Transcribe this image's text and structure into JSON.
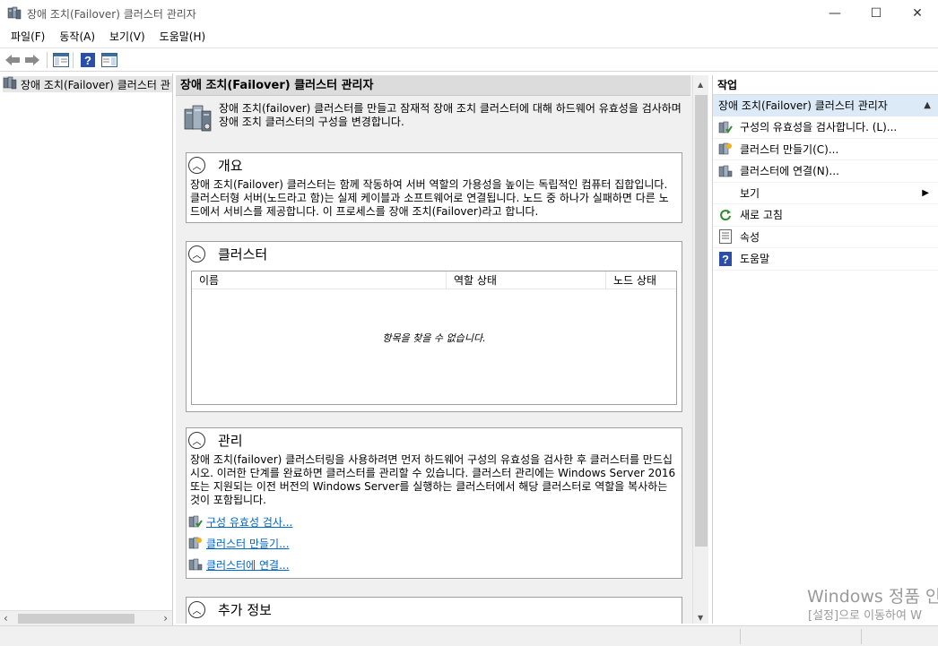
{
  "window": {
    "title": "장애 조치(Failover) 클러스터 관리자",
    "minimize": "—",
    "maximize": "☐",
    "close": "✕"
  },
  "menu": [
    "파일(F)",
    "동작(A)",
    "보기(V)",
    "도움말(H)"
  ],
  "tree": {
    "root_label": "장애 조치(Failover) 클러스터 관"
  },
  "center": {
    "header": "장애 조치(Failover) 클러스터 관리자",
    "intro": "장애 조치(failover) 클러스터를 만들고 잠재적 장애 조치 클러스터에 대해 하드웨어 유효성을 검사하며 장애 조치 클러스터의 구성을 변경합니다.",
    "overview": {
      "title": "개요",
      "body": "장애 조치(Failover) 클러스터는 함께 작동하여 서버 역할의 가용성을 높이는 독립적인 컴퓨터 집합입니다. 클러스터형 서버(노드라고 함)는 실제 케이블과 소프트웨어로 연결됩니다. 노드 중 하나가 실패하면 다른 노드에서 서비스를 제공합니다. 이 프로세스를 장애 조치(Failover)라고 합니다."
    },
    "clusters": {
      "title": "클러스터",
      "columns": [
        "이름",
        "역할 상태",
        "노드 상태"
      ],
      "empty": "항목을 찾을 수 없습니다."
    },
    "manage": {
      "title": "관리",
      "body": "장애 조치(failover) 클러스터링을 사용하려면 먼저 하드웨어 구성의 유효성을 검사한 후 클러스터를 만드십시오. 이러한 단계를 완료하면 클러스터를 관리할 수 있습니다. 클러스터 관리에는 Windows Server 2016 또는 지원되는 이전 버전의 Windows Server를 실행하는 클러스터에서 해당 클러스터로 역할을 복사하는 것이 포함됩니다.",
      "links": [
        "구성 유효성 검사...",
        "클러스터 만들기...",
        "클러스터에 연결..."
      ]
    },
    "more_info": {
      "title": "추가 정보"
    }
  },
  "actions": {
    "title": "작업",
    "subheader": "장애 조치(Failover) 클러스터 관리자",
    "items": [
      "구성의 유효성을 검사합니다. (L)...",
      "클러스터 만들기(C)...",
      "클러스터에 연결(N)...",
      "보기",
      "새로 고침",
      "속성",
      "도움말"
    ]
  },
  "watermark": {
    "line1": "Windows 정품 인",
    "line2": "[설정]으로 이동하여 W"
  },
  "colors": {
    "accent_blue": "#0066cc",
    "selection": "#dce9f6"
  }
}
